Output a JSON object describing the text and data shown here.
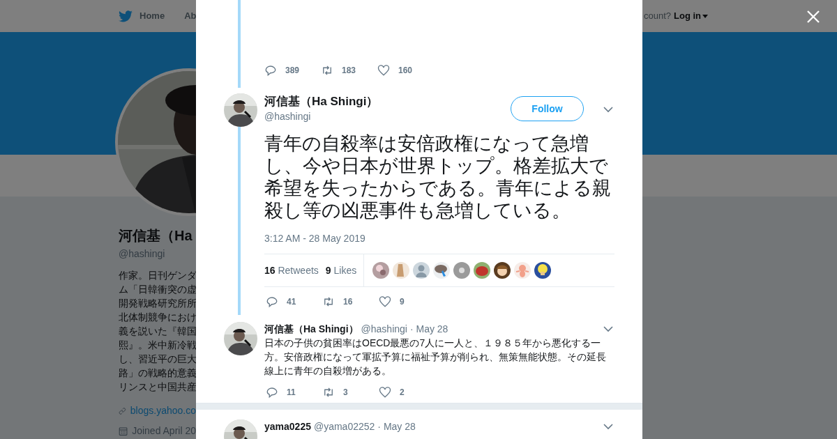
{
  "background_page": {
    "nav": [
      {
        "label": "Home",
        "selected": false
      },
      {
        "label": "Ab",
        "selected": false
      }
    ],
    "login_prompt": "count?",
    "login": "Log in",
    "profile": {
      "name": "河信基（Ha",
      "handle": "@hashingi",
      "bio_lines": [
        "作家。日刊ゲンダ",
        "ム「日韓衝突の虚",
        "開発戦略研究所所",
        "北体制競争におけ",
        "義を説いた『韓国",
        "熙』。米中新冷戦",
        "し、習近平の巨大",
        "路」の戦略的意義",
        "リンスと中国共産"
      ],
      "website": "blogs.yahoo.co",
      "joined": "Joined April 20"
    }
  },
  "modal": {
    "previous_tweet_actions": {
      "replies": "389",
      "retweets": "183",
      "likes": "160"
    },
    "main_tweet": {
      "name": "河信基（Ha Shingi）",
      "handle": "@hashingi",
      "follow": "Follow",
      "text": "青年の自殺率は安倍政権になって急増し、今や日本が世界トップ。格差拡大で希望を失ったからである。青年による親殺し等の凶悪事件も急増している。",
      "timestamp": "3:12 AM - 28 May 2019",
      "retweets_count": "16",
      "retweets_label": "Retweets",
      "likes_count": "9",
      "likes_label": "Likes",
      "actions": {
        "replies": "41",
        "retweets": "16",
        "likes": "9"
      }
    },
    "replies": [
      {
        "name": "河信基（Ha Shingi）",
        "handle": "@hashingi",
        "date": "· May 28",
        "text": "日本の子供の貧困率はOECD最悪の7人に一人と、１９８５年から悪化する一方。安倍政権になって軍拡予算に福祉予算が削られ、無策無能状態。その延長線上に青年の自殺増がある。",
        "actions": {
          "replies": "11",
          "retweets": "3",
          "likes": "2"
        }
      },
      {
        "name": "yama0225",
        "handle": "@yama02252",
        "date": "· May 28"
      }
    ]
  }
}
